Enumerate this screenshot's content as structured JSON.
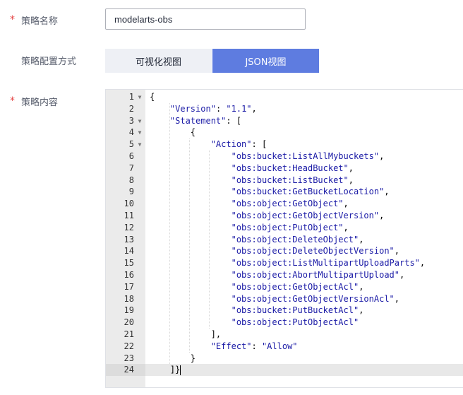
{
  "form": {
    "name_label": "策略名称",
    "name_required": "*",
    "name_value": "modelarts-obs",
    "mode_label": "策略配置方式",
    "mode_options": [
      "可视化视图",
      "JSON视图"
    ],
    "mode_selected": "JSON视图",
    "content_label": "策略内容",
    "content_required": "*"
  },
  "editor": {
    "active_line": 24,
    "lines": [
      {
        "n": "1",
        "fold": true,
        "text": "{"
      },
      {
        "n": "2",
        "fold": false,
        "text": "    \"Version\": \"1.1\","
      },
      {
        "n": "3",
        "fold": true,
        "text": "    \"Statement\": ["
      },
      {
        "n": "4",
        "fold": true,
        "text": "        {"
      },
      {
        "n": "5",
        "fold": true,
        "text": "            \"Action\": ["
      },
      {
        "n": "6",
        "fold": false,
        "text": "                \"obs:bucket:ListAllMybuckets\","
      },
      {
        "n": "7",
        "fold": false,
        "text": "                \"obs:bucket:HeadBucket\","
      },
      {
        "n": "8",
        "fold": false,
        "text": "                \"obs:bucket:ListBucket\","
      },
      {
        "n": "9",
        "fold": false,
        "text": "                \"obs:bucket:GetBucketLocation\","
      },
      {
        "n": "10",
        "fold": false,
        "text": "                \"obs:object:GetObject\","
      },
      {
        "n": "11",
        "fold": false,
        "text": "                \"obs:object:GetObjectVersion\","
      },
      {
        "n": "12",
        "fold": false,
        "text": "                \"obs:object:PutObject\","
      },
      {
        "n": "13",
        "fold": false,
        "text": "                \"obs:object:DeleteObject\","
      },
      {
        "n": "14",
        "fold": false,
        "text": "                \"obs:object:DeleteObjectVersion\","
      },
      {
        "n": "15",
        "fold": false,
        "text": "                \"obs:object:ListMultipartUploadParts\","
      },
      {
        "n": "16",
        "fold": false,
        "text": "                \"obs:object:AbortMultipartUpload\","
      },
      {
        "n": "17",
        "fold": false,
        "text": "                \"obs:object:GetObjectAcl\","
      },
      {
        "n": "18",
        "fold": false,
        "text": "                \"obs:object:GetObjectVersionAcl\","
      },
      {
        "n": "19",
        "fold": false,
        "text": "                \"obs:bucket:PutBucketAcl\","
      },
      {
        "n": "20",
        "fold": false,
        "text": "                \"obs:object:PutObjectAcl\""
      },
      {
        "n": "21",
        "fold": false,
        "text": "            ],"
      },
      {
        "n": "22",
        "fold": false,
        "text": "            \"Effect\": \"Allow\""
      },
      {
        "n": "23",
        "fold": false,
        "text": "        }"
      },
      {
        "n": "24",
        "fold": false,
        "text": "    ]}"
      }
    ]
  }
}
